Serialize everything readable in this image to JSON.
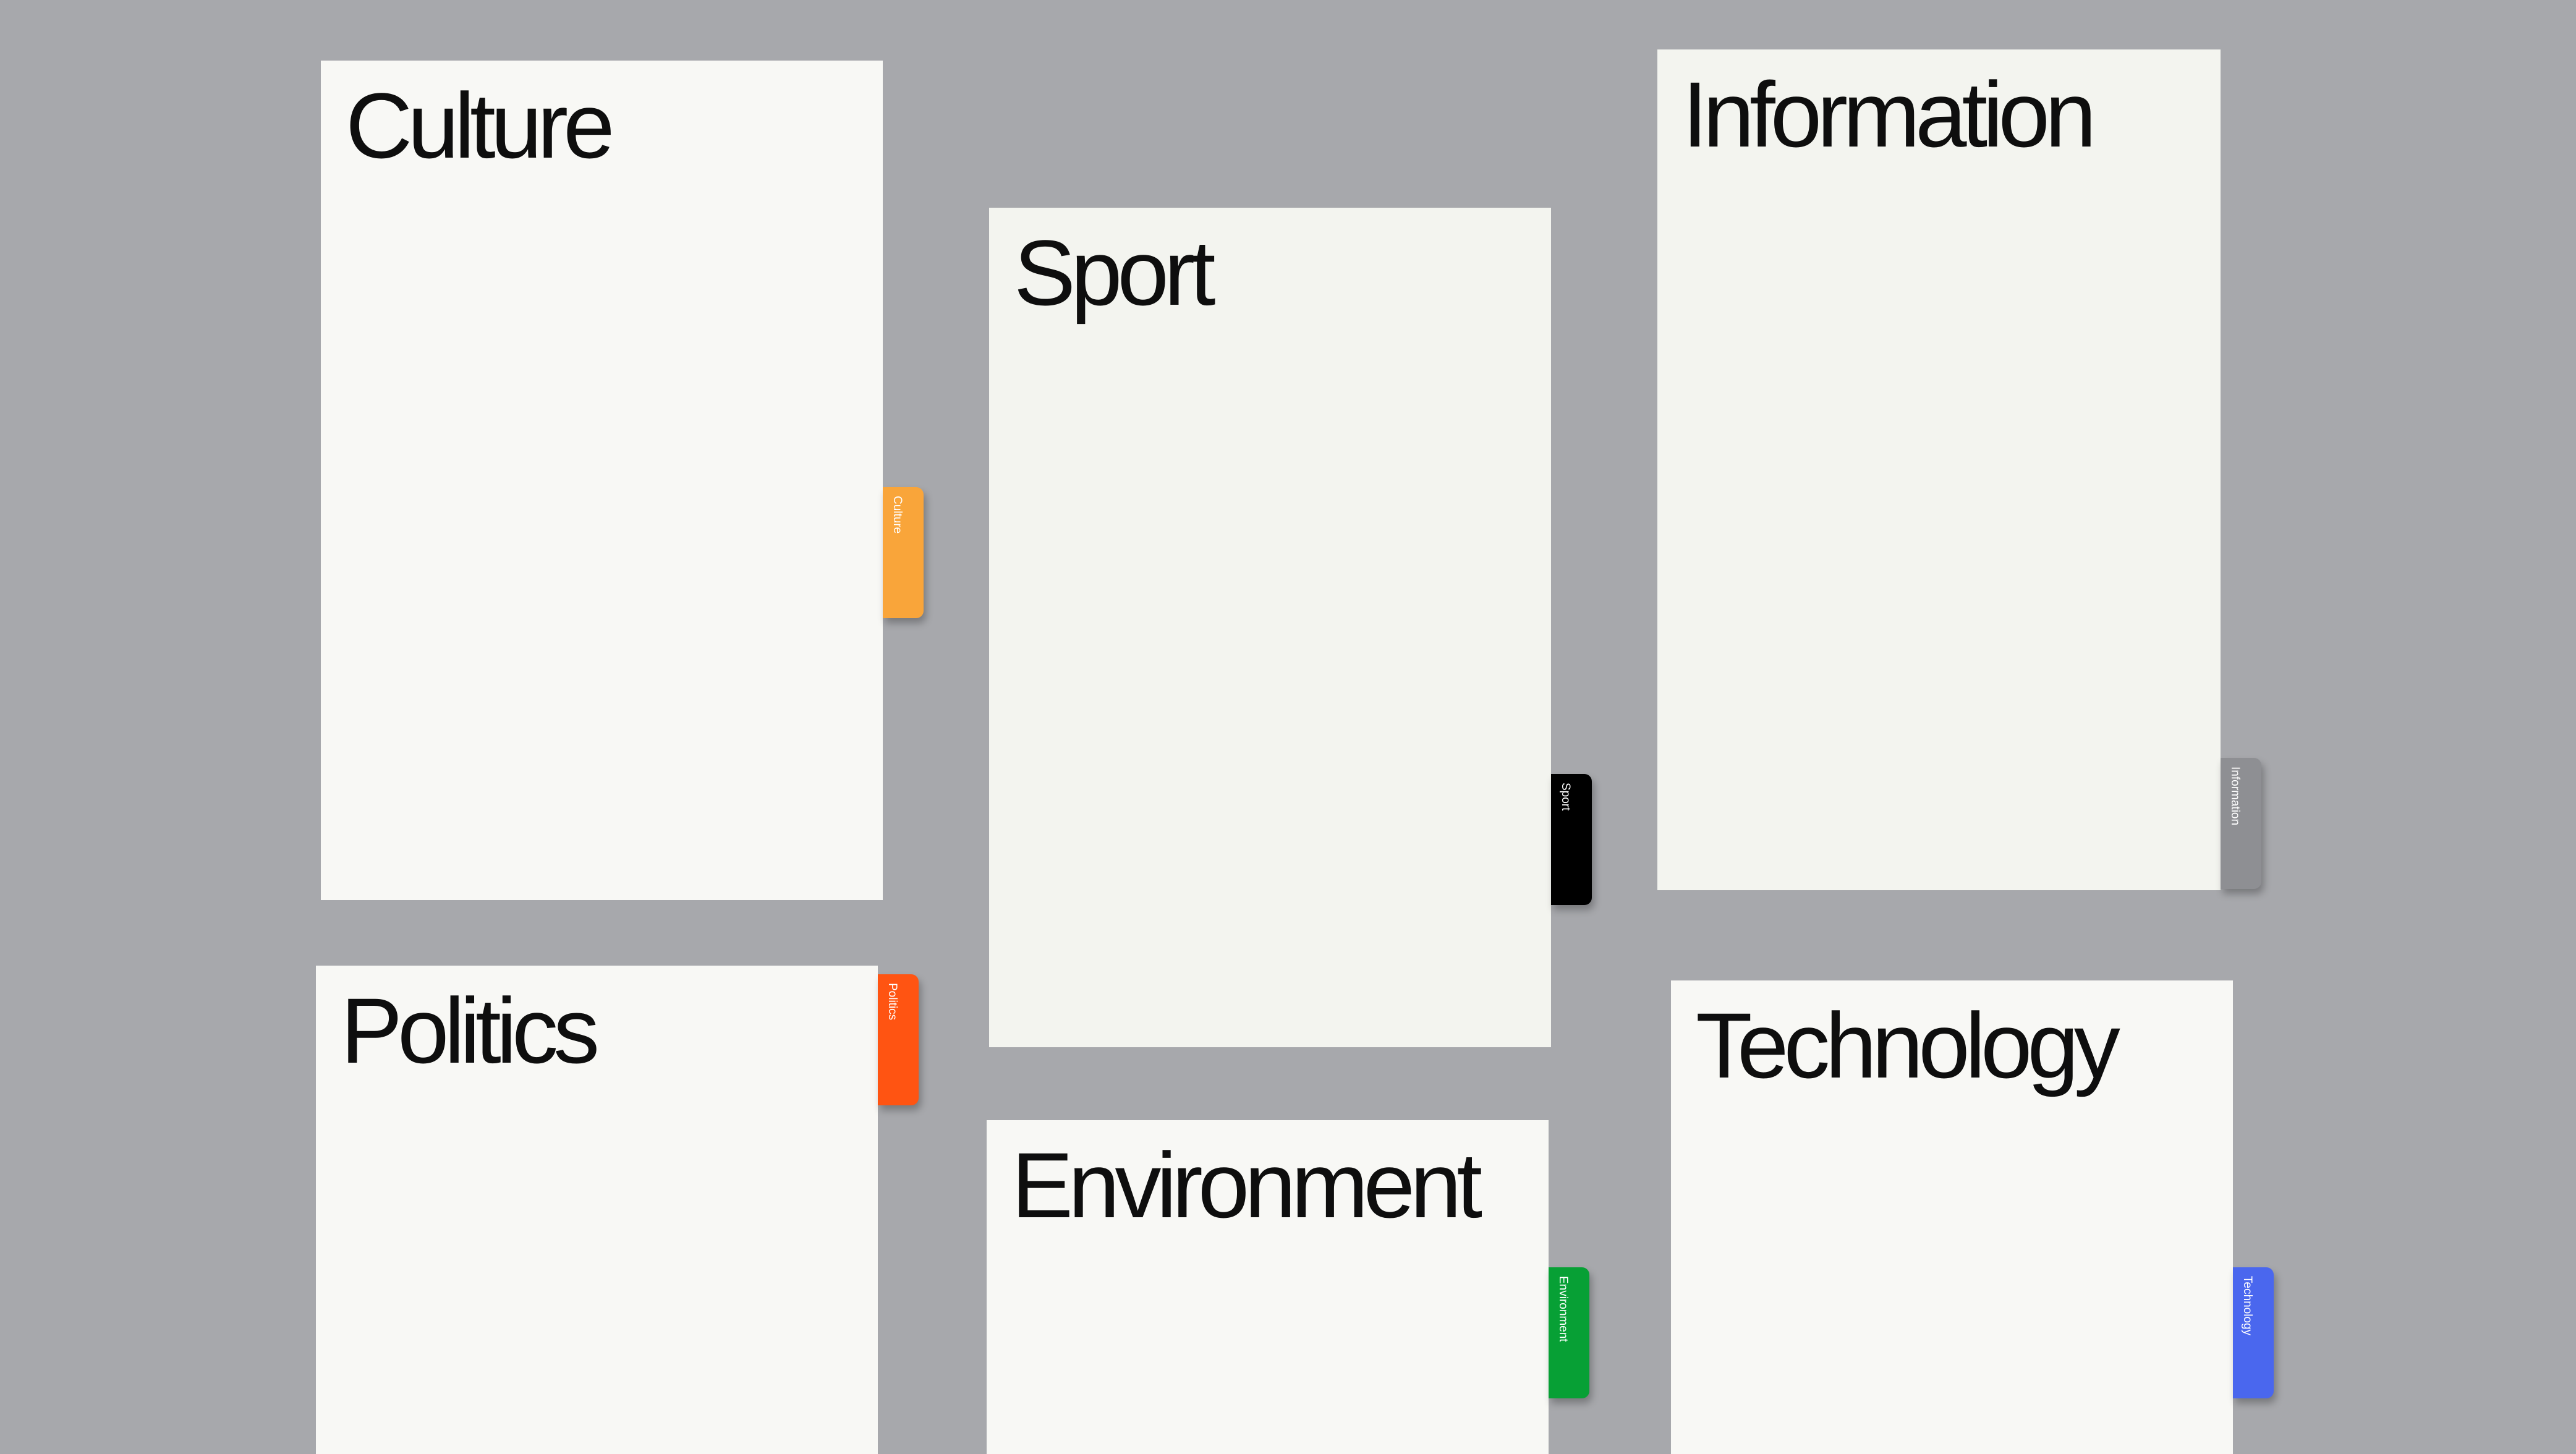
{
  "cards": [
    {
      "id": "culture",
      "title": "Culture",
      "tab_label": "Culture",
      "tab_color": "#f9a53a"
    },
    {
      "id": "sport",
      "title": "Sport",
      "tab_label": "Sport",
      "tab_color": "#000000"
    },
    {
      "id": "information",
      "title": "Information",
      "tab_label": "Information",
      "tab_color": "#8e8f93"
    },
    {
      "id": "politics",
      "title": "Politics",
      "tab_label": "Politics",
      "tab_color": "#ff5412"
    },
    {
      "id": "environment",
      "title": "Environment",
      "tab_label": "Environment",
      "tab_color": "#07a035"
    },
    {
      "id": "technology",
      "title": "Technology",
      "tab_label": "Technology",
      "tab_color": "#4a67ee"
    }
  ],
  "colors": {
    "background": "#a7a8ac",
    "card": "#f8f8f5",
    "title_text": "#0e0e0e",
    "tab_text": "#ffffff"
  }
}
